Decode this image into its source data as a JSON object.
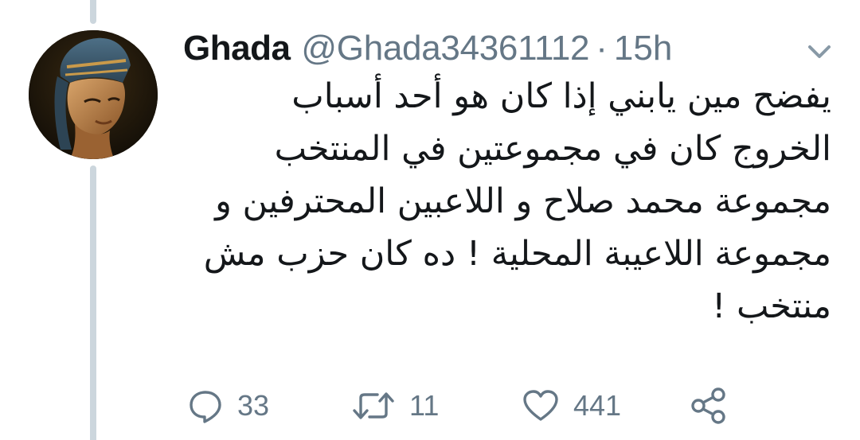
{
  "tweet": {
    "author": {
      "display_name": "Ghada",
      "handle": "@Ghada34361112"
    },
    "separator": "·",
    "time": "15h",
    "text": "يفضح مين يابني إذا كان هو أحد أسباب\nالخروج كان في مجموعتين في المنتخب\nمجموعة محمد صلاح و اللاعبين المحترفين و\nمجموعة اللاعيبة المحلية ! ده كان حزب مش\nمنتخب !",
    "counts": {
      "replies": "33",
      "retweets": "11",
      "likes": "441"
    }
  },
  "icons": {
    "menu": "chevron-down-icon",
    "reply": "speech-bubble-icon",
    "retweet": "retweet-arrows-icon",
    "like": "heart-icon",
    "share": "share-icon"
  },
  "colors": {
    "text": "#14171a",
    "secondary": "#657786",
    "thread_line": "#ccd6dd"
  }
}
